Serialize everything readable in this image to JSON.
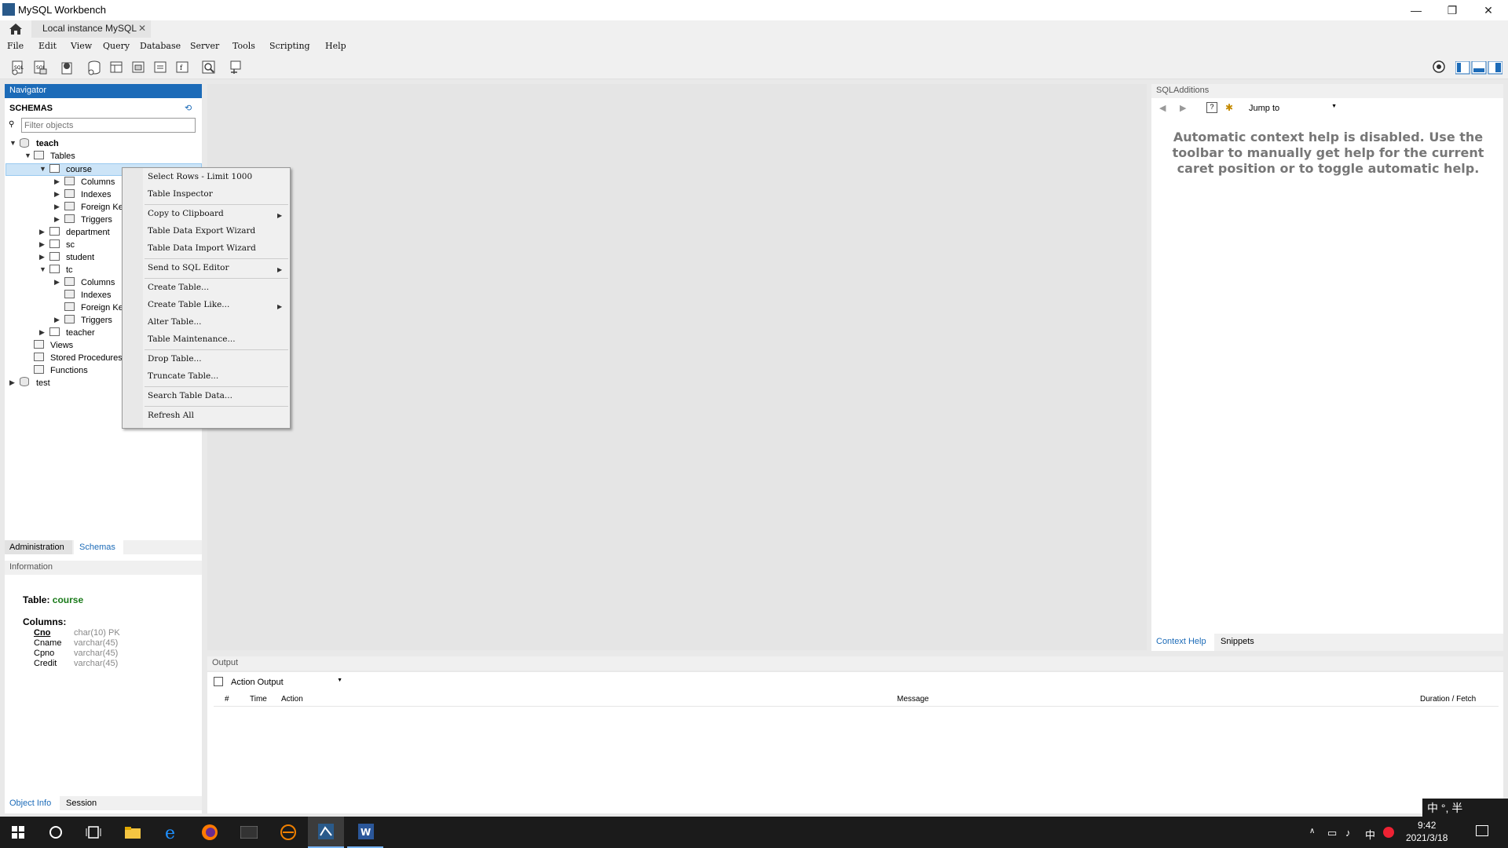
{
  "window": {
    "title": "MySQL Workbench",
    "minimize": "—",
    "restore": "❐",
    "close": "✕"
  },
  "tab": {
    "label": "Local instance MySQL",
    "close": "✕"
  },
  "menu": [
    "File",
    "Edit",
    "View",
    "Query",
    "Database",
    "Server",
    "Tools",
    "Scripting",
    "Help"
  ],
  "navigator": {
    "header": "Navigator",
    "schemas_label": "SCHEMAS",
    "filter_placeholder": "Filter objects",
    "tree": {
      "teach": "teach",
      "tables": "Tables",
      "course": "course",
      "course_columns": "Columns",
      "course_indexes": "Indexes",
      "course_fk": "Foreign Keys",
      "course_triggers": "Triggers",
      "department": "department",
      "sc": "sc",
      "student": "student",
      "tc": "tc",
      "tc_columns": "Columns",
      "tc_indexes": "Indexes",
      "tc_fk": "Foreign Keys",
      "tc_triggers": "Triggers",
      "teacher": "teacher",
      "views": "Views",
      "procedures": "Stored Procedures",
      "functions": "Functions",
      "test": "test"
    },
    "tabs": {
      "administration": "Administration",
      "schemas": "Schemas"
    },
    "information_header": "Information",
    "info": {
      "table_label": "Table:",
      "table_name": "course",
      "columns_label": "Columns:",
      "columns": [
        {
          "name": "Cno",
          "type": "char(10) PK"
        },
        {
          "name": "Cname",
          "type": "varchar(45)"
        },
        {
          "name": "Cpno",
          "type": "varchar(45)"
        },
        {
          "name": "Credit",
          "type": "varchar(45)"
        }
      ]
    },
    "bottom_tabs": {
      "object_info": "Object Info",
      "session": "Session"
    }
  },
  "context_menu": {
    "items": [
      "Select Rows - Limit 1000",
      "Table Inspector",
      "Copy to Clipboard",
      "Table Data Export Wizard",
      "Table Data Import Wizard",
      "Send to SQL Editor",
      "Create Table...",
      "Create Table Like...",
      "Alter Table...",
      "Table Maintenance...",
      "Drop Table...",
      "Truncate Table...",
      "Search Table Data...",
      "Refresh All"
    ]
  },
  "sql_additions": {
    "header": "SQLAdditions",
    "jump_to": "Jump to",
    "help_text": "Automatic context help is disabled. Use the toolbar to manually get help for the current caret position or to toggle automatic help.",
    "tabs": {
      "context_help": "Context Help",
      "snippets": "Snippets"
    }
  },
  "output": {
    "header": "Output",
    "dropdown": "Action Output",
    "columns": [
      "#",
      "Time",
      "Action",
      "Message",
      "Duration / Fetch"
    ]
  },
  "taskbar": {
    "time": "9:42",
    "date": "2021/3/18",
    "ime": "中 °, 半",
    "tray_lang": "中"
  },
  "colors": {
    "accent": "#1c6bb8",
    "table_name": "#1a7a1a",
    "selection": "#cce4f7"
  }
}
